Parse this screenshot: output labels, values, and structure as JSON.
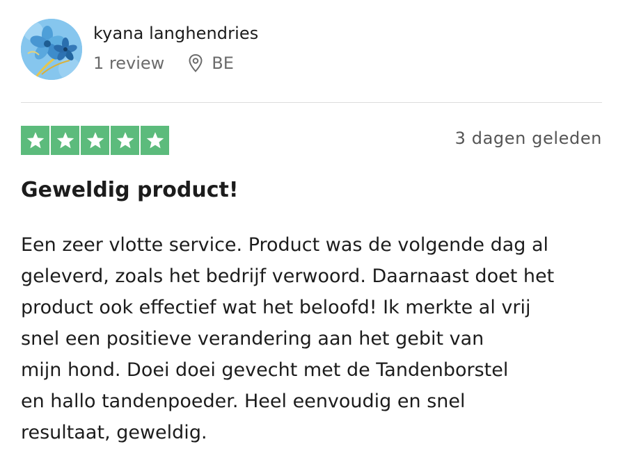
{
  "review": {
    "user": {
      "name": "kyana langhendries",
      "review_count": "1 review",
      "country": "BE",
      "avatar_icon": "flower-avatar-icon"
    },
    "rating": {
      "stars": 5,
      "max_stars": 5,
      "star_color": "#5cbb7c"
    },
    "date": "3 dagen geleden",
    "title": "Geweldig product!",
    "body_lines": [
      "Een zeer vlotte service. Product was de volgende dag al",
      "geleverd, zoals het bedrijf verwoord. Daarnaast doet het",
      "product ook effectief wat het beloofd! Ik merkte al vrij",
      "snel een positieve verandering aan het gebit van",
      "mijn hond. Doei doei gevecht met de Tandenborstel",
      "en hallo tandenpoeder. Heel eenvoudig en snel",
      "resultaat, geweldig."
    ]
  }
}
